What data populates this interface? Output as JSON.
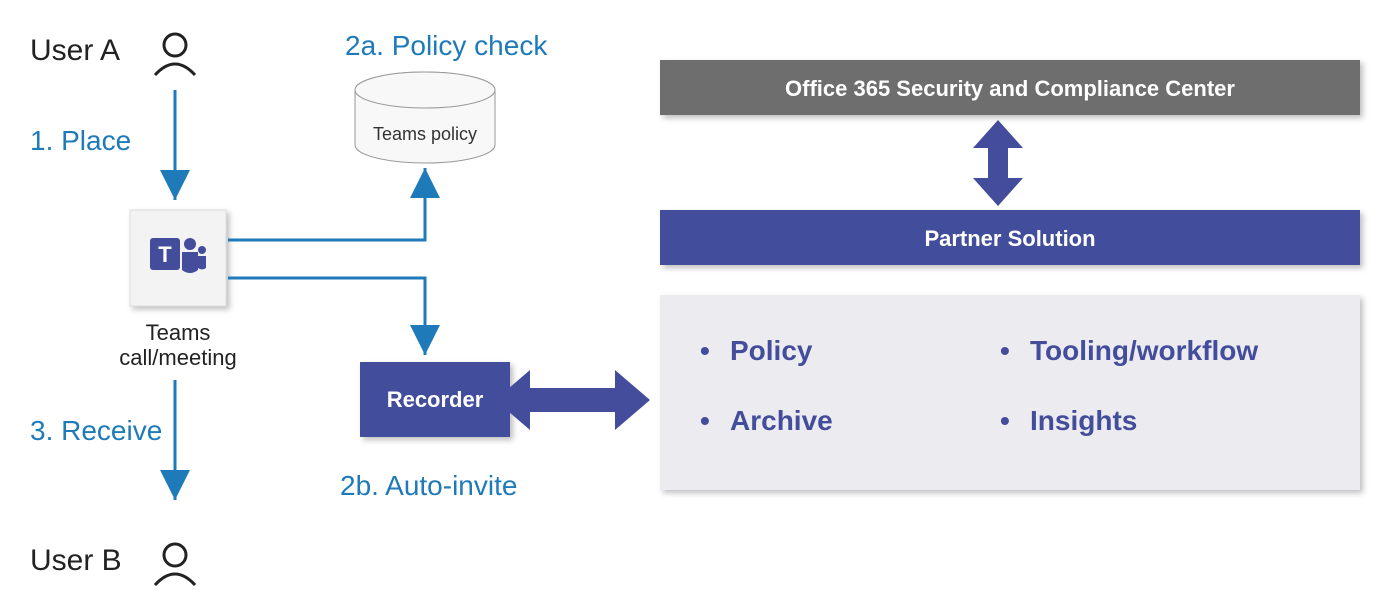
{
  "userA": "User A",
  "userB": "User B",
  "step1": "1. Place",
  "step2a": "2a. Policy check",
  "step2b": "2b. Auto-invite",
  "step3": "3. Receive",
  "teamsPolicy": "Teams policy",
  "teamsCall1": "Teams",
  "teamsCall2": "call/meeting",
  "recorder": "Recorder",
  "compliance": "Office 365 Security and Compliance Center",
  "partner": "Partner Solution",
  "bullet1": "Policy",
  "bullet2": "Tooling/workflow",
  "bullet3": "Archive",
  "bullet4": "Insights",
  "colors": {
    "blueText": "#1e7ab8",
    "indigo": "#434d9b",
    "grayBox": "#6e6e6e",
    "lightGray": "#ececf0"
  }
}
